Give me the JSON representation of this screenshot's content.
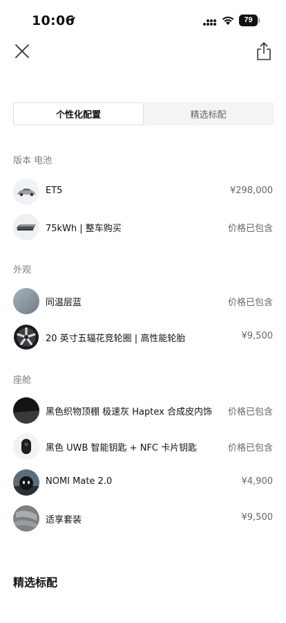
{
  "status_bar": {
    "time": "10:06",
    "battery": "79"
  },
  "tabs": [
    {
      "label": "个性化配置",
      "active": true
    },
    {
      "label": "精选标配",
      "active": false
    }
  ],
  "sections": {
    "version_battery": "版本 电池",
    "exterior": "外观",
    "cabin": "座舱"
  },
  "items": [
    {
      "name": "ET5",
      "price": "¥298,000",
      "icon": "car-thumbnail"
    },
    {
      "name": "75kWh | 整车购买",
      "price": "价格已包含",
      "icon": "battery-pack-thumbnail"
    },
    {
      "name": "同温层蓝",
      "price": "价格已包含",
      "icon": "paint-color-swatch"
    },
    {
      "name": "20 英寸五辐花竞轮圈 | 高性能轮胎",
      "price": "¥9,500",
      "icon": "wheel-thumbnail"
    },
    {
      "name": "黑色织物顶棚 极速灰 Haptex 合成皮内饰",
      "price": "价格已包含",
      "icon": "interior-color-swatch"
    },
    {
      "name": "黑色 UWB 智能钥匙 + NFC 卡片钥匙",
      "price": "价格已包含",
      "icon": "smart-key-thumbnail"
    },
    {
      "name": "NOMI Mate 2.0",
      "price": "¥4,900",
      "icon": "nomi-thumbnail"
    },
    {
      "name": "适享套装",
      "price": "¥9,500",
      "icon": "seat-package-thumbnail"
    }
  ],
  "bottom_heading": "精选标配",
  "colors": {
    "accent_text": "#111111",
    "muted_text": "#7a7f87",
    "tab_bg": "#f3f4f6",
    "paint_blue": "#8c99a3"
  }
}
